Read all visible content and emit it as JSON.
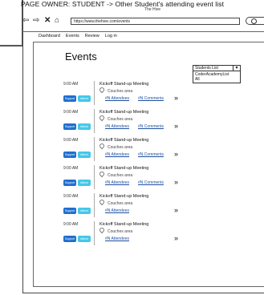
{
  "page_owner": "PAGE OWNER: STUDENT -> Other Student's attending event list",
  "window_title": "The Hive",
  "browser": {
    "url": "https://www.thehive.com/events",
    "back_icon": "back-arrow-icon",
    "forward_icon": "forward-arrow-icon",
    "close_icon": "close-icon",
    "home_icon": "home-icon"
  },
  "nav": [
    "Dashboard",
    "Events",
    "Review",
    "Log in"
  ],
  "page_title": "Events",
  "dropdown": {
    "selected": "Students List",
    "options": [
      "CoderAcademyList",
      "All"
    ]
  },
  "events": [
    {
      "time": "9:00 AM",
      "title": "Kickoff Stand-up Meeting",
      "location": "Couches area",
      "support": "Support",
      "attend": "Attend",
      "attendees": "#N Attendees",
      "comments": "#N Comments"
    },
    {
      "time": "9:00 AM",
      "title": "Kickoff Stand-up Meeting",
      "location": "Couches area",
      "support": "Support",
      "attend": "Attend",
      "attendees": "#N Attendees",
      "comments": "#N Comments"
    },
    {
      "time": "9:00 AM",
      "title": "Kickoff Stand-up Meeting",
      "location": "Couches area",
      "support": "Support",
      "attend": "Attend",
      "attendees": "#N Attendees",
      "comments": "#N Comments"
    },
    {
      "time": "9:00 AM",
      "title": "Kickoff Stand-up Meeting",
      "location": "Couches area",
      "support": "Support",
      "attend": "Attend",
      "attendees": "#N Attendees",
      "comments": "#N Comments"
    },
    {
      "time": "9:00 AM",
      "title": "Kickoff Stand-up Meeting",
      "location": "Couches area",
      "support": "Support",
      "attend": "Attend",
      "attendees": "#N Attendees",
      "comments": ""
    },
    {
      "time": "9:00 AM",
      "title": "Kickoff Stand-up Meeting",
      "location": "Couches area",
      "support": "Support",
      "attend": "Attend",
      "attendees": "#N Attendees",
      "comments": ""
    }
  ],
  "more_glyph": "»",
  "colors": {
    "support": "#1f6fd0",
    "attend": "#44c8e8",
    "link": "#1f4fa0"
  }
}
